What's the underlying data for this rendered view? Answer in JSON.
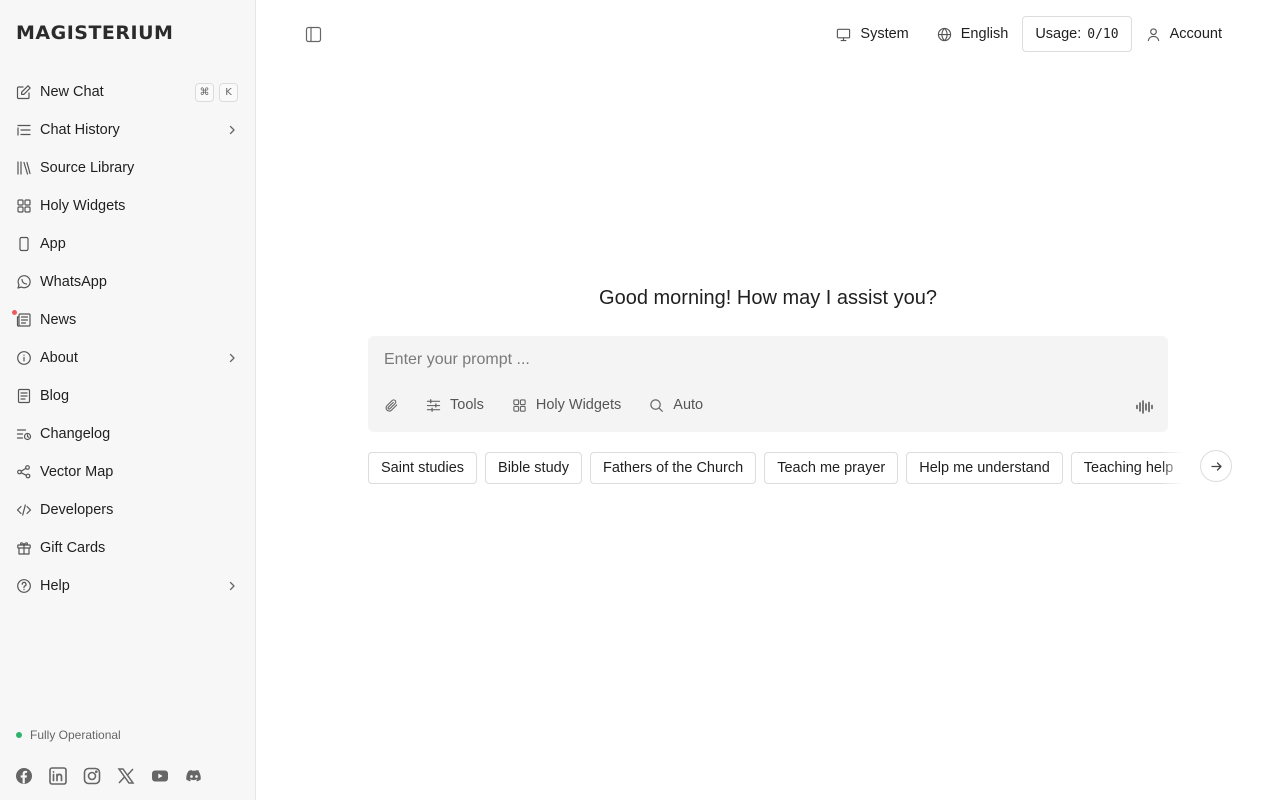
{
  "sidebar": {
    "logo": "MAGISTERIUM",
    "new_chat_shortcut": [
      "⌘",
      "K"
    ],
    "items": [
      {
        "label": "New Chat",
        "icon": "edit-icon"
      },
      {
        "label": "Chat History",
        "icon": "list-icon",
        "has_submenu": true
      },
      {
        "label": "Source Library",
        "icon": "library-icon"
      },
      {
        "label": "Holy Widgets",
        "icon": "grid-icon"
      },
      {
        "label": "App",
        "icon": "phone-icon"
      },
      {
        "label": "WhatsApp",
        "icon": "whatsapp-icon"
      },
      {
        "label": "News",
        "icon": "newspaper-icon",
        "badge_dot": true
      },
      {
        "label": "About",
        "icon": "info-icon",
        "has_submenu": true
      },
      {
        "label": "Blog",
        "icon": "document-icon"
      },
      {
        "label": "Changelog",
        "icon": "changelog-icon"
      },
      {
        "label": "Vector Map",
        "icon": "network-icon"
      },
      {
        "label": "Developers",
        "icon": "code-icon"
      },
      {
        "label": "Gift Cards",
        "icon": "gift-icon"
      },
      {
        "label": "Help",
        "icon": "help-icon",
        "has_submenu": true
      }
    ],
    "status": "Fully Operational",
    "socials": [
      "facebook-icon",
      "linkedin-icon",
      "instagram-icon",
      "x-icon",
      "youtube-icon",
      "discord-icon"
    ]
  },
  "topbar": {
    "theme": "System",
    "language": "English",
    "usage_label": "Usage:",
    "usage_value": "0/10",
    "account": "Account"
  },
  "main": {
    "greeting": "Good morning! How may I assist you?",
    "prompt_placeholder": "Enter your prompt ...",
    "tools": {
      "tools_label": "Tools",
      "widgets_label": "Holy Widgets",
      "mode_label": "Auto"
    },
    "chips": [
      "Saint studies",
      "Bible study",
      "Fathers of the Church",
      "Teach me prayer",
      "Help me understand",
      "Teaching help"
    ]
  },
  "colors": {
    "sidebar_bg": "#f7f7f7",
    "prompt_bg": "#f4f4f4",
    "status_green": "#2fb36b",
    "news_dot": "#ef5b5b"
  }
}
